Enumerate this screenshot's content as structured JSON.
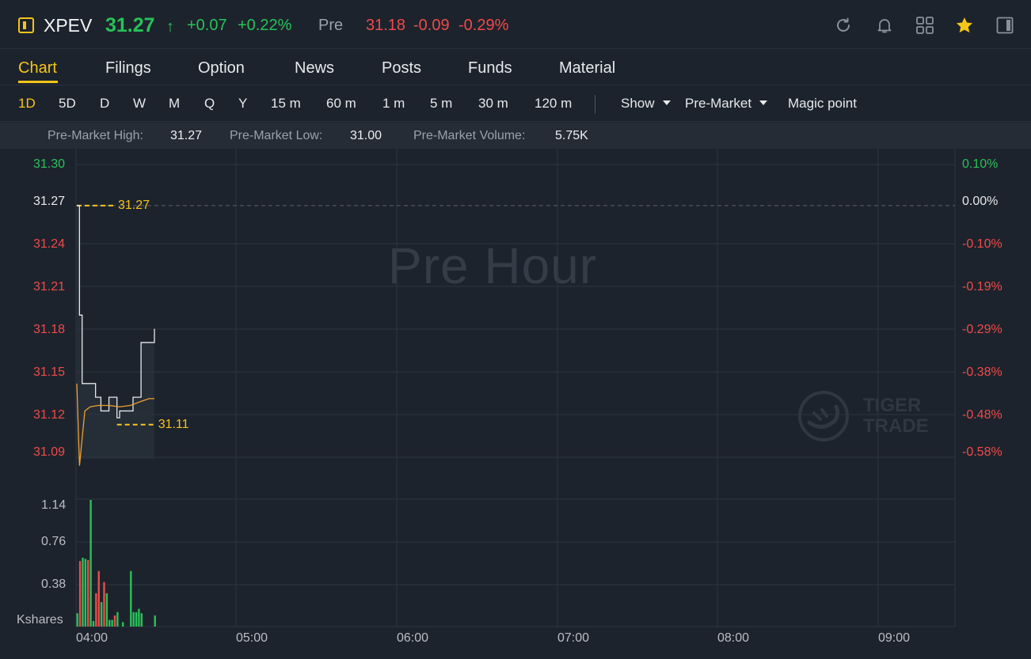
{
  "header": {
    "symbol": "XPEV",
    "price": "31.27",
    "arrow": "↑",
    "change": "+0.07",
    "change_pct": "+0.22%",
    "pre_label": "Pre",
    "pre_price": "31.18",
    "pre_change": "-0.09",
    "pre_change_pct": "-0.29%",
    "icons": [
      "refresh-icon",
      "bell-icon",
      "grid-icon",
      "star-icon",
      "panel-icon"
    ],
    "accent": "#f5c518",
    "up_color": "#27c25a",
    "down_color": "#ef4a4a"
  },
  "tabs": [
    "Chart",
    "Filings",
    "Option",
    "News",
    "Posts",
    "Funds",
    "Material"
  ],
  "active_tab": "Chart",
  "periods": [
    "1D",
    "5D",
    "D",
    "W",
    "M",
    "Q",
    "Y",
    "15 m",
    "60 m",
    "1 m",
    "5 m",
    "30 m",
    "120 m"
  ],
  "active_period": "1D",
  "toolbar": {
    "show_label": "Show",
    "session_label": "Pre-Market",
    "magic_label": "Magic point"
  },
  "stats": {
    "high_label": "Pre-Market High:",
    "high_value": "31.27",
    "low_label": "Pre-Market Low:",
    "low_value": "31.00",
    "volume_label": "Pre-Market Volume:",
    "volume_value": "5.75K"
  },
  "chart_data": {
    "type": "line",
    "watermark": "Pre Hour",
    "brand_watermark": [
      "TIGER",
      "TRADE"
    ],
    "price_axis": [
      "31.30",
      "31.27",
      "31.24",
      "31.21",
      "31.18",
      "31.15",
      "31.12",
      "31.09"
    ],
    "pct_axis": [
      "0.10%",
      "0.00%",
      "-0.10%",
      "-0.19%",
      "-0.29%",
      "-0.38%",
      "-0.48%",
      "-0.58%"
    ],
    "volume_axis": [
      "1.14",
      "0.76",
      "0.38",
      "Kshares"
    ],
    "time_axis": [
      "04:00",
      "05:00",
      "06:00",
      "07:00",
      "08:00",
      "09:00"
    ],
    "ylim": [
      31.085,
      31.3
    ],
    "xlim_minutes": [
      0,
      330
    ],
    "reference_price": 31.27,
    "high_marker": "31.27",
    "low_marker": "31.11",
    "series": [
      {
        "name": "price",
        "color": "#e6e8ec",
        "x": [
          0,
          1,
          2,
          3,
          6,
          7,
          9,
          10,
          12,
          14,
          15,
          16,
          17,
          19,
          21,
          22,
          24,
          26,
          27,
          29
        ],
        "values": [
          31.27,
          31.19,
          31.14,
          31.14,
          31.14,
          31.13,
          31.12,
          31.12,
          31.13,
          31.13,
          31.115,
          31.12,
          31.12,
          31.12,
          31.13,
          31.13,
          31.17,
          31.17,
          31.17,
          31.18
        ]
      },
      {
        "name": "average",
        "color": "#f0a030",
        "x": [
          0,
          1,
          2,
          3,
          5,
          8,
          12,
          16,
          20,
          24,
          27,
          29
        ],
        "values": [
          31.14,
          31.08,
          31.1,
          31.12,
          31.123,
          31.124,
          31.124,
          31.123,
          31.124,
          31.127,
          31.129,
          31.129
        ]
      }
    ],
    "volume": {
      "x": [
        0,
        1,
        2,
        3,
        4,
        5,
        6,
        7,
        8,
        9,
        10,
        11,
        12,
        13,
        14,
        15,
        16,
        17,
        18,
        19,
        20,
        21,
        22,
        23,
        24,
        25,
        26,
        27,
        28,
        29
      ],
      "values": [
        0.12,
        0.59,
        0.62,
        0.61,
        0.6,
        1.14,
        0.05,
        0.3,
        0.5,
        0.22,
        0.4,
        0.3,
        0.06,
        0.06,
        0.1,
        0.13,
        0,
        0.04,
        0,
        0,
        0.5,
        0.13,
        0.13,
        0.16,
        0.12,
        0,
        0,
        0,
        0,
        0.1
      ],
      "colors": [
        "green",
        "red",
        "green",
        "green",
        "red",
        "green",
        "green",
        "red",
        "red",
        "green",
        "red",
        "green",
        "green",
        "green",
        "red",
        "green",
        "green",
        "green",
        "green",
        "green",
        "green",
        "green",
        "green",
        "green",
        "green",
        "green",
        "green",
        "green",
        "green",
        "green"
      ]
    }
  }
}
